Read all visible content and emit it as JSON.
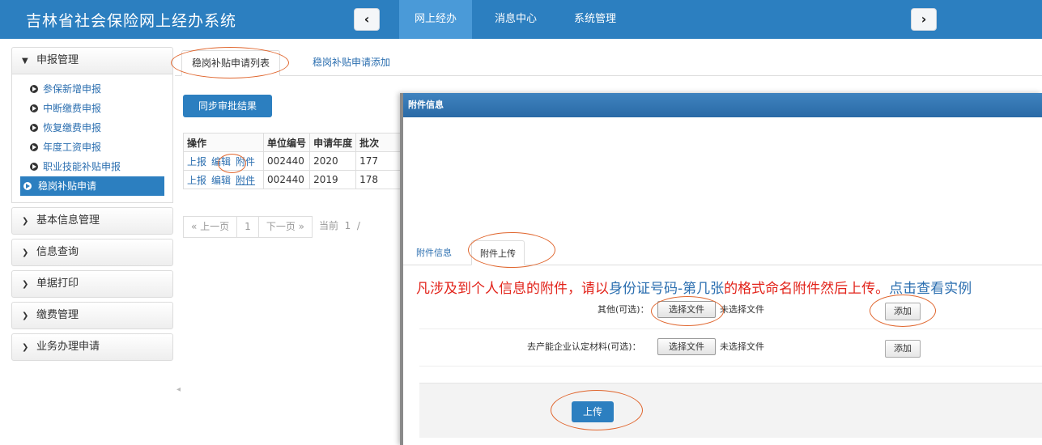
{
  "header": {
    "title": "吉林省社会保险网上经办系统",
    "tabs": [
      {
        "label": "网上经办",
        "active": true
      },
      {
        "label": "消息中心",
        "active": false
      },
      {
        "label": "系统管理",
        "active": false
      }
    ],
    "prev_icon": "chevron-left-icon",
    "next_icon": "chevron-right-icon",
    "accent_color": "#2c7fc0"
  },
  "sidebar": {
    "open_section": "申报管理",
    "items": [
      {
        "label": "参保新增申报"
      },
      {
        "label": "中断缴费申报"
      },
      {
        "label": "恢复缴费申报"
      },
      {
        "label": "年度工资申报"
      },
      {
        "label": "职业技能补贴申报"
      },
      {
        "label": "稳岗补贴申请",
        "active": true
      }
    ],
    "sections": [
      {
        "label": "基本信息管理"
      },
      {
        "label": "信息查询"
      },
      {
        "label": "单据打印"
      },
      {
        "label": "缴费管理"
      },
      {
        "label": "业务办理申请"
      }
    ]
  },
  "tabs": [
    {
      "label": "稳岗补贴申请列表",
      "active": true
    },
    {
      "label": "稳岗补贴申请添加",
      "active": false
    }
  ],
  "sync_button": "同步审批结果",
  "table": {
    "headers": [
      "操作",
      "单位编号",
      "申请年度",
      "批次"
    ],
    "rows": [
      {
        "ops": [
          "上报",
          "编辑",
          "附件"
        ],
        "unit": "002440",
        "year": "2020",
        "batch": "177"
      },
      {
        "ops": [
          "上报",
          "编辑",
          "附件"
        ],
        "unit": "002440",
        "year": "2019",
        "batch": "178"
      }
    ]
  },
  "pager": {
    "prev": "« 上一页",
    "page": "1",
    "next": "下一页 »",
    "current_label": "当前",
    "current_value": "1",
    "slash": "/"
  },
  "modal": {
    "title": "附件信息",
    "tabs": [
      {
        "label": "附件信息",
        "active": false
      },
      {
        "label": "附件上传",
        "active": true
      }
    ],
    "notice": {
      "part1": "凡涉及到个人信息的附件，请以",
      "part2": "身份证号码-第几张",
      "part3": "的格式命名附件然后上传。",
      "link": "点击查看实例"
    },
    "files": [
      {
        "label": "其他(可选)：",
        "choose": "选择文件",
        "status": "未选择文件",
        "add": "添加"
      },
      {
        "label": "去产能企业认定材料(可选)：",
        "choose": "选择文件",
        "status": "未选择文件",
        "add": "添加"
      }
    ],
    "upload": "上传"
  }
}
